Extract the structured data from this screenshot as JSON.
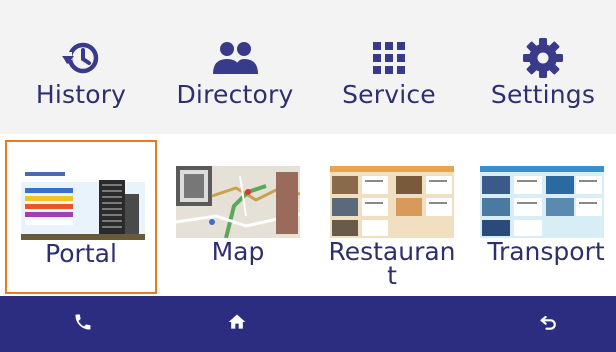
{
  "top_menu": {
    "items": [
      {
        "label": "History",
        "icon": "history-icon"
      },
      {
        "label": "Directory",
        "icon": "directory-icon"
      },
      {
        "label": "Service",
        "icon": "service-grid-icon"
      },
      {
        "label": "Settings",
        "icon": "settings-gear-icon"
      }
    ]
  },
  "apps": {
    "items": [
      {
        "label": "Portal",
        "selected": true,
        "thumbnail": "portal-thumbnail"
      },
      {
        "label": "Map",
        "selected": false,
        "thumbnail": "map-thumbnail"
      },
      {
        "label": "Restauran t",
        "selected": false,
        "thumbnail": "restaurant-thumbnail"
      },
      {
        "label": "Transport",
        "selected": false,
        "thumbnail": "transport-thumbnail"
      }
    ]
  },
  "bottom_nav": {
    "items": [
      {
        "icon": "phone-icon"
      },
      {
        "icon": "home-icon"
      },
      {
        "icon": "back-icon"
      }
    ]
  },
  "colors": {
    "accent_text": "#2f2f70",
    "icon": "#3a3a8a",
    "nav_bar": "#2c2d80",
    "selection_border": "#e87b1e",
    "top_bar_bg": "#f3f3f3"
  }
}
